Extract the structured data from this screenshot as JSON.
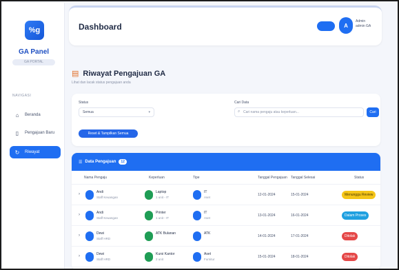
{
  "app": {
    "brand": "GA Panel",
    "brand_sub": "GA PORTAL",
    "logo_glyph": "%g"
  },
  "sidebar": {
    "menu_title": "NAVIGASI",
    "items": [
      {
        "label": "Beranda",
        "icon": "home-icon",
        "active": false
      },
      {
        "label": "Pengajuan Baru",
        "icon": "document-icon",
        "active": false
      },
      {
        "label": "Riwayat",
        "icon": "history-icon",
        "active": true
      }
    ]
  },
  "topbar": {
    "title": "Dashboard",
    "user_initial": "A",
    "user_name": "Admin",
    "user_role": "admin GA"
  },
  "page": {
    "title": "Riwayat Pengajuan GA",
    "subtitle": "Lihat dan lacak status pengajuan anda"
  },
  "filters": {
    "status_label": "Status",
    "status_value": "Semua",
    "search_label": "Cari Data",
    "search_placeholder": "Cari nama pengaju atau keperluan...",
    "search_button": "Cari",
    "reset_button": "Reset & Tampilkan Semua"
  },
  "table": {
    "header_title": "Data Pengajuan",
    "count": "12",
    "columns": [
      "Nama Pengaju",
      "Keperluan",
      "Tipe",
      "Tanggal Pengajuan",
      "Tanggal Selesai",
      "Status"
    ],
    "rows": [
      {
        "name": "Andi",
        "sub": "Staff Keuangan",
        "item": "Laptop",
        "item_sub": "1 unit - IT",
        "type": "IT",
        "type_sub": "Aset",
        "date1": "12-01-2024",
        "date2": "15-01-2024",
        "status": "Menunggu Review",
        "status_color": "#f5c518",
        "status_text_color": "#4a3a00"
      },
      {
        "name": "Andi",
        "sub": "Staff Keuangan",
        "item": "Printer",
        "item_sub": "1 unit - IT",
        "type": "IT",
        "type_sub": "Aset",
        "date1": "13-01-2024",
        "date2": "16-01-2024",
        "status": "Dalam Proses",
        "status_color": "#1fa0e0",
        "status_text_color": "#ffffff"
      },
      {
        "name": "Dewi",
        "sub": "Staff HRD",
        "item": "ATK Bulanan",
        "item_sub": "",
        "type": "ATK",
        "type_sub": "",
        "date1": "14-01-2024",
        "date2": "17-01-2024",
        "status": "Ditolak",
        "status_color": "#e54848",
        "status_text_color": "#ffffff"
      },
      {
        "name": "Dewi",
        "sub": "Staff HRD",
        "item": "Kursi Kantor",
        "item_sub": "2 unit",
        "type": "Aset",
        "type_sub": "Furnitur",
        "date1": "15-01-2024",
        "date2": "18-01-2024",
        "status": "Ditolak",
        "status_color": "#e54848",
        "status_text_color": "#ffffff"
      }
    ]
  },
  "colors": {
    "primary": "#1f6ef2",
    "sidebar_bg": "#ffffff",
    "page_bg": "#f4f6fb",
    "icon_green": "#1f9d55"
  }
}
